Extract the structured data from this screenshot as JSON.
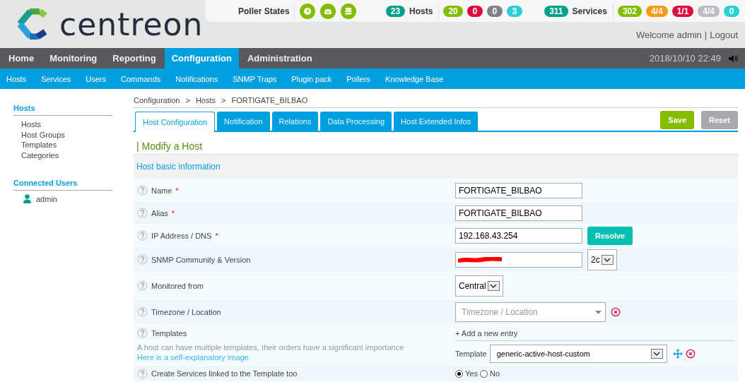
{
  "logo": {
    "text": "centreon"
  },
  "status": {
    "poller_label": "Poller States",
    "hosts": {
      "total": {
        "value": "23",
        "color": "#00a08a"
      },
      "label": "Hosts",
      "counts": [
        {
          "value": "20",
          "color": "#84bd00"
        },
        {
          "value": "0",
          "color": "#e00b3d"
        },
        {
          "value": "0",
          "color": "#818285"
        },
        {
          "value": "3",
          "color": "#29d1d7"
        }
      ]
    },
    "services": {
      "total": {
        "value": "311",
        "color": "#00a08a"
      },
      "label": "Services",
      "counts": [
        {
          "value": "302",
          "color": "#84bd00"
        },
        {
          "value": "4/4",
          "color": "#ff9a13"
        },
        {
          "value": "1/1",
          "color": "#e00b3d"
        },
        {
          "value": "4/4",
          "color": "#bcbdc0"
        },
        {
          "value": "0",
          "color": "#29d1d7"
        }
      ]
    }
  },
  "user": {
    "welcome": "Welcome admin",
    "separator": "|",
    "logout": "Logout"
  },
  "nav": {
    "items": [
      {
        "label": "Home",
        "selected": false
      },
      {
        "label": "Monitoring",
        "selected": false
      },
      {
        "label": "Reporting",
        "selected": false
      },
      {
        "label": "Configuration",
        "selected": true
      },
      {
        "label": "Administration",
        "selected": false
      }
    ],
    "clock": "2018/10/10 22:49"
  },
  "subnav": [
    "Hosts",
    "Services",
    "Users",
    "Commands",
    "Notifications",
    "SNMP Traps",
    "Plugin pack",
    "Pollers",
    "Knowledge Base"
  ],
  "sidebar": [
    {
      "kind": "links",
      "title": "Hosts",
      "items": [
        "Hosts",
        "Host Groups",
        "Templates",
        "Categories"
      ]
    },
    {
      "kind": "users",
      "title": "Connected Users",
      "items": [
        "admin"
      ]
    }
  ],
  "breadcrumb": {
    "items": [
      "Configuration",
      "Hosts",
      "FORTIGATE_BILBAO"
    ],
    "separator": ">"
  },
  "tabs": [
    {
      "label": "Host Configuration",
      "selected": true
    },
    {
      "label": "Notification",
      "selected": false
    },
    {
      "label": "Relations",
      "selected": false
    },
    {
      "label": "Data Processing",
      "selected": false
    },
    {
      "label": "Host Extended Infos",
      "selected": false
    }
  ],
  "buttons": {
    "save": "Save",
    "reset": "Reset"
  },
  "title": "| Modify a Host",
  "section": "Host basic information",
  "fields": [
    {
      "kind": "text",
      "label": "Name",
      "required_mark": "*",
      "value": "FORTIGATE_BILBAO"
    },
    {
      "kind": "text",
      "label": "Alias",
      "required_mark": "*",
      "value": "FORTIGATE_BILBAO"
    },
    {
      "kind": "text",
      "label": "IP Address / DNS",
      "required_mark": "*",
      "value": "192.168.43.254",
      "button": "Resolve"
    },
    {
      "kind": "snmp",
      "label": "SNMP Community & Version",
      "redacted": true,
      "version": "2c"
    },
    {
      "kind": "select",
      "label": "Monitored from",
      "value": "Central"
    },
    {
      "kind": "combo",
      "label": "Timezone / Location",
      "placeholder": "Timezone / Location"
    },
    {
      "kind": "templates",
      "label": "Templates",
      "help": "A host can have multiple templates, their orders have a significant importance",
      "link": "Here is a self-explanatory image.",
      "add": "+ Add a new entry",
      "entry_label": "Template",
      "value": "generic-active-host-custom"
    },
    {
      "kind": "radio",
      "label": "Create Services linked to the Template too",
      "options": [
        {
          "label": "Yes",
          "selected": true
        },
        {
          "label": "No",
          "selected": false
        }
      ]
    }
  ]
}
